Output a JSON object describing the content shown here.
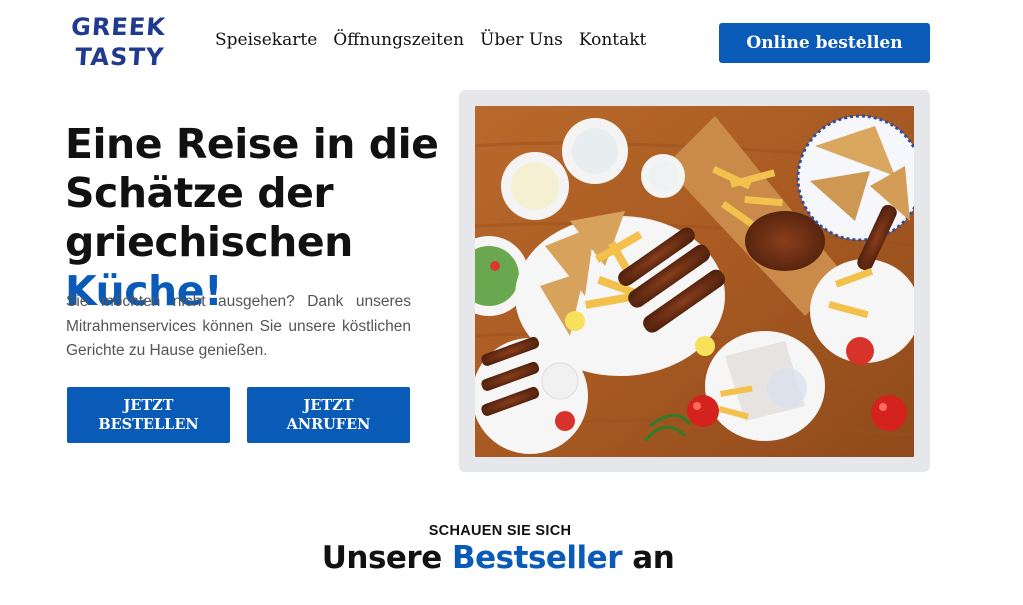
{
  "brand": {
    "logo_line1": "GREEK",
    "logo_line2": "TASTY",
    "color": "#1f3a8f"
  },
  "nav": {
    "items": [
      "Speisekarte",
      "Öffnungszeiten",
      "Über Uns",
      "Kontakt"
    ],
    "cta_label": "Online bestellen"
  },
  "hero": {
    "title_line1": "Eine Reise in die",
    "title_line2": "Schätze der",
    "title_line3_plain": "griechischen ",
    "title_line3_accent": "Küche!",
    "description": "Sie möchten nicht ausgehen? Dank unseres Mitrahmenservices können Sie unsere köstlichen Gerichte zu Hause genießen.",
    "button_order_line1": "JETZT",
    "button_order_line2": "BESTELLEN",
    "button_call_line1": "JETZT",
    "button_call_line2": "ANRUFEN"
  },
  "bestsellers": {
    "kicker": "SCHAUEN SIE SICH",
    "title_plain_before": "Unsere ",
    "title_accent": "Bestseller",
    "title_plain_after": " an"
  },
  "colors": {
    "accent": "#0a5bb8",
    "frame": "#e6e7eb",
    "text_muted": "#555555"
  }
}
